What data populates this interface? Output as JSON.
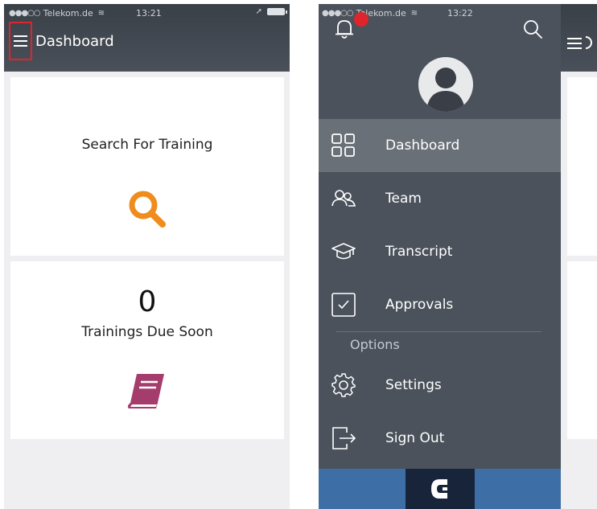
{
  "left": {
    "status": {
      "carrier": "Telekom.de",
      "time": "13:21"
    },
    "header": {
      "title": "Dashboard"
    },
    "cards": [
      {
        "label": "Search For Training",
        "icon": "search-icon"
      },
      {
        "count": "0",
        "label": "Trainings Due Soon",
        "icon": "book-icon"
      }
    ]
  },
  "right": {
    "status": {
      "carrier": "Telekom.de",
      "time": "13:22"
    },
    "notifications": {
      "icon": "bell-icon"
    },
    "menu": [
      {
        "label": "Dashboard",
        "icon": "grid-icon",
        "active": true
      },
      {
        "label": "Team",
        "icon": "team-icon"
      },
      {
        "label": "Transcript",
        "icon": "graduation-cap-icon"
      },
      {
        "label": "Approvals",
        "icon": "checkbox-icon"
      }
    ],
    "options_label": "Options",
    "options_menu": [
      {
        "label": "Settings",
        "icon": "gear-icon"
      },
      {
        "label": "Sign Out",
        "icon": "sign-out-icon"
      }
    ]
  },
  "colors": {
    "header": "#444a52",
    "drawer": "#4b525b",
    "active_item": "#6a7078",
    "search_orange": "#f08c1e",
    "book_purple": "#a43d6c",
    "highlight_red": "#e0242b",
    "footer_blue": "#3d6fa6"
  }
}
